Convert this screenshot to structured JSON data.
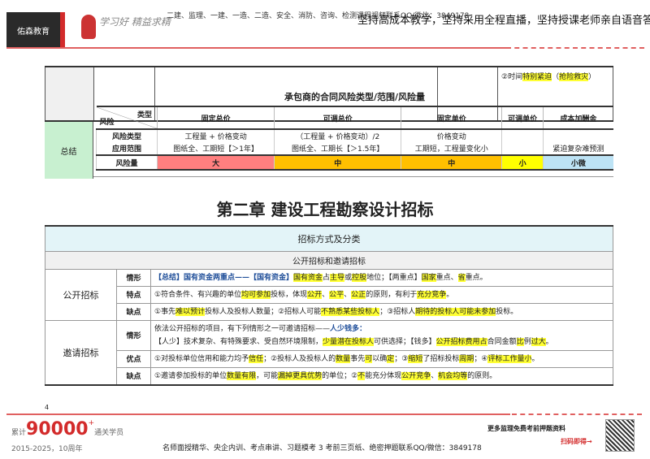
{
  "header": {
    "logo": "佑森教育",
    "signature": "学习好  精益求精",
    "small": "二建、监理、一建、一造、二造、安全、消防、咨询、检测课程视频联系QQ/微信：3849178",
    "big": "坚持高成本教学，坚持采用全程直播，坚持授课老师亲自语音答疑"
  },
  "top_table": {
    "note_prefix": "②时间",
    "note_h1": "特别紧迫",
    "note_p1": "（",
    "note_h2": "抢险救灾",
    "note_p2": "）"
  },
  "summary": {
    "label": "总结",
    "title": "承包商的合同风险类型/范围/风险量",
    "corner_top": "类型",
    "corner_bottom": "风险",
    "columns": [
      "固定总价",
      "可调总价",
      "固定单价",
      "可调单价",
      "成本加酬金"
    ],
    "rows": [
      {
        "label": "风险类型",
        "cells": [
          "工程量 + 价格变动",
          "（工程量 + 价格变动）/2",
          "价格变动",
          "",
          ""
        ]
      },
      {
        "label": "应用范围",
        "cells": [
          "图纸全、工期短【＞1年】",
          "图纸全、工期长【＞1.5年】",
          "工期短，工程量变化小",
          "",
          "紧迫复杂难预测"
        ]
      }
    ],
    "risk_label": "风险量",
    "risk": [
      "大",
      "中",
      "中",
      "小",
      "小微"
    ],
    "risk_colors": [
      "#ff7f7f",
      "#ffc000",
      "#ffc000",
      "#ffff00",
      "#bde3f5"
    ]
  },
  "chapter_title": "第二章  建设工程勘察设计招标",
  "bidding": {
    "caption": "招标方式及分类",
    "subcaption": "公开招标和邀请招标",
    "groups": [
      {
        "name": "公开招标",
        "rows": [
          {
            "key": "情形",
            "lines": [
              [
                {
                  "t": "【总结】国有资金两重点——【国有资金】",
                  "b": 1
                },
                {
                  "t": "国有资金",
                  "h": 1
                },
                {
                  "t": "占"
                },
                {
                  "t": "主导",
                  "h": 1
                },
                {
                  "t": "或"
                },
                {
                  "t": "控股",
                  "h": 1
                },
                {
                  "t": "地位；【两重点】"
                },
                {
                  "t": "国家",
                  "h": 1
                },
                {
                  "t": "重点、"
                },
                {
                  "t": "省",
                  "h": 1
                },
                {
                  "t": "重点。"
                }
              ]
            ]
          },
          {
            "key": "特点",
            "lines": [
              [
                {
                  "t": "①符合条件、有兴趣的单位"
                },
                {
                  "t": "均可参加",
                  "h": 1
                },
                {
                  "t": "投标，体现"
                },
                {
                  "t": "公开",
                  "h": 1
                },
                {
                  "t": "、"
                },
                {
                  "t": "公平",
                  "h": 1
                },
                {
                  "t": "、"
                },
                {
                  "t": "公正",
                  "h": 1
                },
                {
                  "t": "的原则，有利于"
                },
                {
                  "t": "充分竞争",
                  "h": 1
                },
                {
                  "t": "。"
                }
              ]
            ]
          },
          {
            "key": "缺点",
            "lines": [
              [
                {
                  "t": "①事先"
                },
                {
                  "t": "难以预计",
                  "h": 1
                },
                {
                  "t": "投标人及投标人数量；②招标人可能"
                },
                {
                  "t": "不熟悉某些投标人",
                  "h": 1
                },
                {
                  "t": "；③招标人"
                },
                {
                  "t": "期待的投标人可能未参加",
                  "h": 1
                },
                {
                  "t": "投标。"
                }
              ]
            ]
          }
        ]
      },
      {
        "name": "邀请招标",
        "rows": [
          {
            "key": "情形",
            "lines": [
              [
                {
                  "t": "依法公开招标的项目，有下列情形之一可邀请招标——"
                },
                {
                  "t": "人少钱多：",
                  "b": 1
                }
              ],
              [
                {
                  "t": "【人少】技术复杂、有特殊要求、受自然环境限制，"
                },
                {
                  "t": "少量潜在投标人",
                  "h": 1
                },
                {
                  "t": "可供选择；【钱多】"
                },
                {
                  "t": "公开招标费用占",
                  "h": 1
                },
                {
                  "t": "合同金额"
                },
                {
                  "t": "比",
                  "h": 1
                },
                {
                  "t": "例"
                },
                {
                  "t": "过大",
                  "h": 1
                },
                {
                  "t": "。"
                }
              ]
            ]
          },
          {
            "key": "优点",
            "lines": [
              [
                {
                  "t": "①对投标单位信用和能力均予"
                },
                {
                  "t": "信任",
                  "h": 1
                },
                {
                  "t": "；②投标人及投标人的"
                },
                {
                  "t": "数量",
                  "h": 1
                },
                {
                  "t": "事先"
                },
                {
                  "t": "可",
                  "h": 1
                },
                {
                  "t": "以确"
                },
                {
                  "t": "定",
                  "h": 1
                },
                {
                  "t": "；③"
                },
                {
                  "t": "缩短",
                  "h": 1
                },
                {
                  "t": "了招标投标"
                },
                {
                  "t": "周期",
                  "h": 1
                },
                {
                  "t": "；④"
                },
                {
                  "t": "评标工作量小",
                  "h": 1
                },
                {
                  "t": "。"
                }
              ]
            ]
          },
          {
            "key": "缺点",
            "lines": [
              [
                {
                  "t": "①邀请参加投标的单位"
                },
                {
                  "t": "数量有限",
                  "h": 1
                },
                {
                  "t": "，可能"
                },
                {
                  "t": "漏掉更具优势",
                  "h": 1
                },
                {
                  "t": "的单位；②"
                },
                {
                  "t": "不",
                  "h": 1
                },
                {
                  "t": "能充分体现"
                },
                {
                  "t": "公开竞争",
                  "h": 1
                },
                {
                  "t": "、"
                },
                {
                  "t": "机会均等",
                  "h": 1
                },
                {
                  "t": "的原则。"
                }
              ]
            ]
          }
        ]
      }
    ]
  },
  "footer": {
    "page_prev": "4",
    "cum_prefix": "累计",
    "cum_num": "90000",
    "cum_plus": "+",
    "cum_suffix": "通关学员",
    "years": "2015-2025，10周年",
    "middle": "名师面授精华、央企内训、考点串讲、习题模考 3 考前三页纸、绝密押题联系QQ/微信：3849178",
    "more": "更多监理免费考前押题资料",
    "scan": "扫码即得→"
  }
}
